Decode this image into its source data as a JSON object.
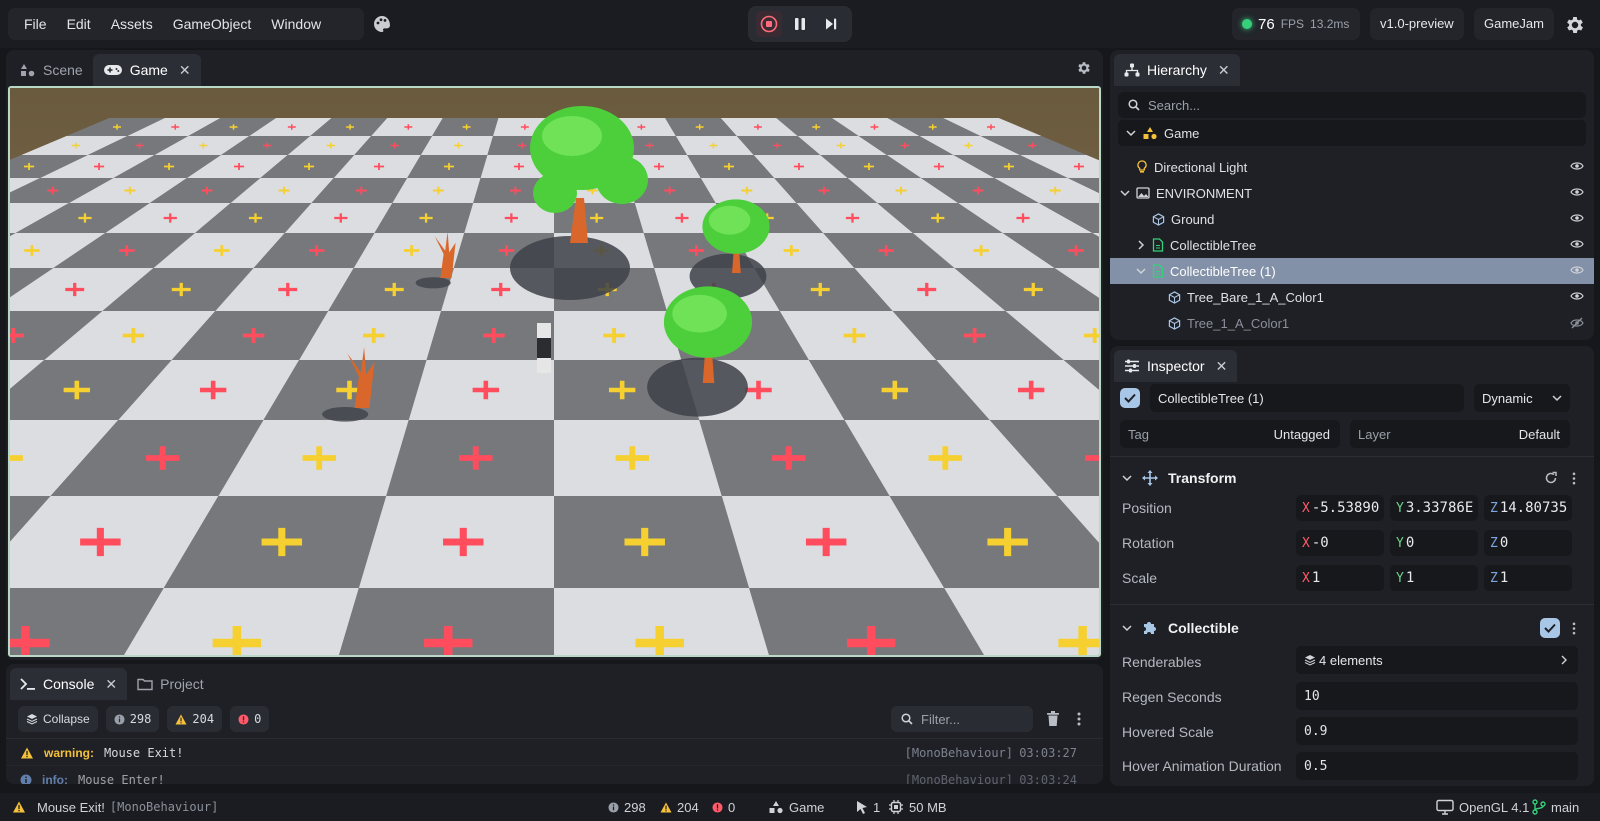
{
  "menu": {
    "items": [
      "File",
      "Edit",
      "Assets",
      "GameObject",
      "Window"
    ]
  },
  "icons": {
    "palette": "palette-icon",
    "stop": "stop-icon",
    "pause": "pause-icon",
    "step": "step-forward-icon",
    "settings": "gear-icon"
  },
  "stats": {
    "fps": "76",
    "fps_unit": "FPS",
    "frame_ms": "13.2ms"
  },
  "version_chip": "v1.0-preview",
  "project_chip": "GameJam",
  "game_panel": {
    "tabs": [
      {
        "label": "Scene",
        "active": false
      },
      {
        "label": "Game",
        "active": true
      }
    ]
  },
  "console": {
    "tabs": [
      {
        "label": "Console",
        "active": true
      },
      {
        "label": "Project",
        "active": false
      }
    ],
    "collapse_label": "Collapse",
    "info_count": "298",
    "warning_count": "204",
    "error_count": "0",
    "filter_placeholder": "Filter...",
    "logs": [
      {
        "level": "warning:",
        "message": "Mouse Exit!",
        "source": "[MonoBehaviour]",
        "time": "03:03:27",
        "color": "#f5c03a"
      },
      {
        "level": "info:",
        "message": "Mouse Enter!",
        "source": "[MonoBehaviour]",
        "time": "03:03:24",
        "color": "#7fa7e3"
      }
    ]
  },
  "hierarchy": {
    "tab_label": "Hierarchy",
    "search_placeholder": "Search...",
    "root": "Game",
    "items": [
      {
        "label": "Directional Light",
        "depth": 0,
        "icon": "light-bulb-icon",
        "expander": "none",
        "selected": false,
        "hidden": false
      },
      {
        "label": "ENVIRONMENT",
        "depth": 0,
        "icon": "image-icon",
        "expander": "open",
        "selected": false,
        "hidden": false
      },
      {
        "label": "Ground",
        "depth": 1,
        "icon": "cube-icon",
        "expander": "none",
        "selected": false,
        "hidden": false
      },
      {
        "label": "CollectibleTree",
        "depth": 1,
        "icon": "script-file-icon",
        "expander": "closed",
        "selected": false,
        "hidden": false
      },
      {
        "label": "CollectibleTree (1)",
        "depth": 1,
        "icon": "script-file-icon",
        "expander": "open",
        "selected": true,
        "hidden": false
      },
      {
        "label": "Tree_Bare_1_A_Color1",
        "depth": 2,
        "icon": "cube-icon",
        "expander": "none",
        "selected": false,
        "hidden": false
      },
      {
        "label": "Tree_1_A_Color1",
        "depth": 2,
        "icon": "cube-icon",
        "expander": "none",
        "selected": false,
        "hidden": true
      }
    ]
  },
  "inspector": {
    "tab_label": "Inspector",
    "object_name": "CollectibleTree (1)",
    "body_type": "Dynamic",
    "tag_label": "Tag",
    "tag_value": "Untagged",
    "layer_label": "Layer",
    "layer_value": "Default",
    "transform": {
      "title": "Transform",
      "position_label": "Position",
      "position": {
        "x": "-5.53890",
        "y": "3.33786E",
        "z": "14.80735"
      },
      "rotation_label": "Rotation",
      "rotation": {
        "x": "-0",
        "y": "0",
        "z": "0"
      },
      "scale_label": "Scale",
      "scale": {
        "x": "1",
        "y": "1",
        "z": "1"
      }
    },
    "collectible": {
      "title": "Collectible",
      "renderables_label": "Renderables",
      "renderables_value": "4 elements",
      "regen_label": "Regen Seconds",
      "regen_value": "10",
      "hover_scale_label": "Hovered Scale",
      "hover_scale_value": "0.9",
      "hover_anim_label": "Hover Animation Duration",
      "hover_anim_value": "0.5"
    }
  },
  "status": {
    "message": "Mouse Exit!",
    "message_source": "[MonoBehaviour]",
    "info_count": "298",
    "warning_count": "204",
    "error_count": "0",
    "scene": "Game",
    "selected_count": "1",
    "memory": "50 MB",
    "renderer": "OpenGL 4.1",
    "branch": "main"
  },
  "colors": {
    "accent_green": "#36d07a",
    "warning": "#f5c03a",
    "error": "#ff5a6a",
    "info": "#7fa7e3",
    "selection": "#8391a8"
  }
}
